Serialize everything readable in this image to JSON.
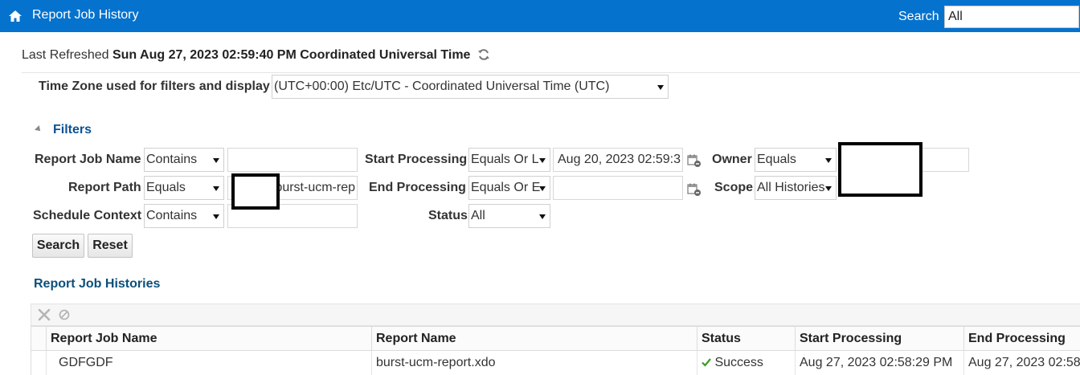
{
  "header": {
    "title": "Report Job History",
    "search_label": "Search",
    "search_value": "All"
  },
  "refresh": {
    "label": "Last Refreshed",
    "datetime": "Sun Aug 27, 2023 02:59:40 PM Coordinated Universal Time"
  },
  "timezone": {
    "label": "Time Zone used for filters and display",
    "value": "(UTC+00:00) Etc/UTC - Coordinated Universal Time (UTC)"
  },
  "filters": {
    "heading": "Filters",
    "report_job_name": {
      "label": "Report Job Name",
      "operator": "Contains",
      "value": ""
    },
    "report_path": {
      "label": "Report Path",
      "operator": "Equals",
      "value": "burst-ucm-rep"
    },
    "schedule_context": {
      "label": "Schedule Context",
      "operator": "Contains",
      "value": ""
    },
    "start_processing": {
      "label": "Start Processing",
      "operator": "Equals Or L",
      "value": "Aug 20, 2023 02:59:3"
    },
    "end_processing": {
      "label": "End Processing",
      "operator": "Equals Or E",
      "value": ""
    },
    "status": {
      "label": "Status",
      "value": "All"
    },
    "owner": {
      "label": "Owner",
      "operator": "Equals",
      "value": ""
    },
    "scope": {
      "label": "Scope",
      "value": "All Histories"
    },
    "search_button": "Search",
    "reset_button": "Reset"
  },
  "histories": {
    "title": "Report Job Histories",
    "columns": [
      "Report Job Name",
      "Report Name",
      "Status",
      "Start Processing",
      "End Processing"
    ],
    "rows": [
      {
        "job_name": "GDFGDF",
        "report_name": "burst-ucm-report.xdo",
        "status": "Success",
        "start": "Aug 27, 2023 02:58:29 PM",
        "end": "Aug 27, 2023 02:58"
      }
    ]
  },
  "colors": {
    "header_bg": "#0572ce",
    "link_blue": "#0b5394",
    "success_green": "#3a9d23"
  },
  "icons": [
    "home-icon",
    "refresh-icon",
    "collapse-triangle-icon",
    "calendar-icon",
    "delete-icon",
    "cancel-icon",
    "checkmark-icon",
    "dropdown-arrow-icon"
  ]
}
